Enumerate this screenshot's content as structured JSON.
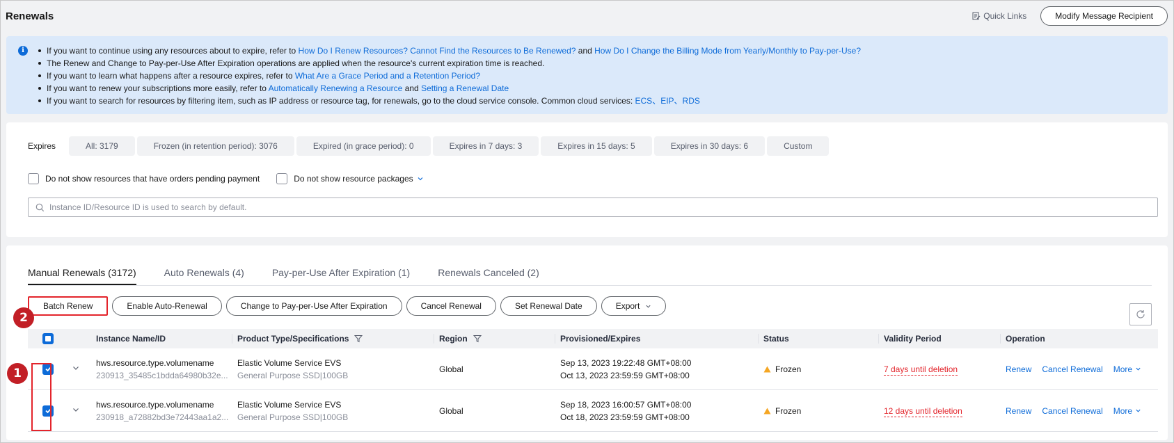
{
  "header": {
    "title": "Renewals",
    "quick_links": "Quick Links",
    "modify_button": "Modify Message Recipient"
  },
  "info": {
    "line1_text": "If you want to continue using any resources about to expire, refer to ",
    "line1_link1": "How Do I Renew Resources? Cannot Find the Resources to Be Renewed?",
    "line1_and": " and ",
    "line1_link2": "How Do I Change the Billing Mode from Yearly/Monthly to Pay-per-Use?",
    "line2_text": "The Renew and Change to Pay-per-Use After Expiration operations are applied when the resource's current expiration time is reached.",
    "line3_text": "If you want to learn what happens after a resource expires, refer to ",
    "line3_link": "What Are a Grace Period and a Retention Period?",
    "line4_text": "If you want to renew your subscriptions more easily, refer to ",
    "line4_link1": "Automatically Renewing a Resource",
    "line4_and": " and ",
    "line4_link2": "Setting a Renewal Date",
    "line5_text": "If you want to search for resources by filtering item, such as IP address or resource tag, for renewals, go to the cloud service console. Common cloud services: ",
    "line5_link": "ECS、EIP、RDS"
  },
  "filters": {
    "expires_label": "Expires",
    "chips": [
      "All: 3179",
      "Frozen (in retention period): 3076",
      "Expired (in grace period): 0",
      "Expires in 7 days: 3",
      "Expires in 15 days: 5",
      "Expires in 30 days: 6",
      "Custom"
    ],
    "checkbox1": "Do not show resources that have orders pending payment",
    "checkbox2": "Do not show resource packages",
    "search_placeholder": "Instance ID/Resource ID is used to search by default."
  },
  "tabs": [
    "Manual Renewals (3172)",
    "Auto Renewals (4)",
    "Pay-per-Use After Expiration (1)",
    "Renewals Canceled (2)"
  ],
  "toolbar": {
    "batch_renew": "Batch Renew",
    "enable_auto": "Enable Auto-Renewal",
    "change_ppu": "Change to Pay-per-Use After Expiration",
    "cancel_renewal": "Cancel Renewal",
    "set_date": "Set Renewal Date",
    "export": "Export"
  },
  "table": {
    "headers": {
      "instance": "Instance Name/ID",
      "product": "Product Type/Specifications",
      "region": "Region",
      "provisioned": "Provisioned/Expires",
      "status": "Status",
      "validity": "Validity Period",
      "operation": "Operation"
    },
    "rows": [
      {
        "name": "hws.resource.type.volumename",
        "id": "230913_35485c1bdda64980b32e...",
        "product": "Elastic Volume Service EVS",
        "spec": "General Purpose SSD|100GB",
        "region": "Global",
        "provisioned": "Sep 13, 2023 19:22:48 GMT+08:00",
        "expires": "Oct 13, 2023 23:59:59 GMT+08:00",
        "status": "Frozen",
        "validity": "7 days until deletion",
        "op_renew": "Renew",
        "op_cancel": "Cancel Renewal",
        "op_more": "More"
      },
      {
        "name": "hws.resource.type.volumename",
        "id": "230918_a72882bd3e72443aa1a2...",
        "product": "Elastic Volume Service EVS",
        "spec": "General Purpose SSD|100GB",
        "region": "Global",
        "provisioned": "Sep 18, 2023 16:00:57 GMT+08:00",
        "expires": "Oct 18, 2023 23:59:59 GMT+08:00",
        "status": "Frozen",
        "validity": "12 days until deletion",
        "op_renew": "Renew",
        "op_cancel": "Cancel Renewal",
        "op_more": "More"
      }
    ]
  },
  "annotations": {
    "badge1": "1",
    "badge2": "2"
  },
  "colors": {
    "link": "#0d6bd8",
    "danger": "#e3242b",
    "warning": "#f5a623",
    "info_bg": "#dbe9fa"
  }
}
